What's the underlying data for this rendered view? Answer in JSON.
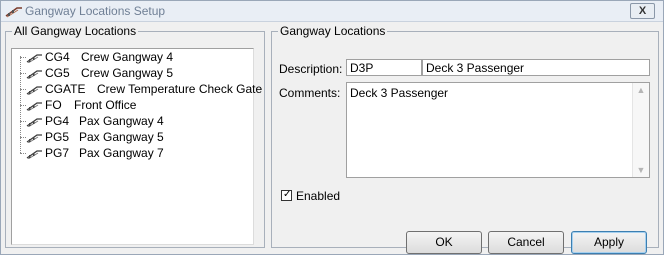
{
  "window": {
    "title": "Gangway Locations Setup",
    "close_glyph": "X",
    "icon": "gangway-icon"
  },
  "left_panel": {
    "legend": "All Gangway Locations",
    "items": [
      {
        "code": "CG4",
        "name": "Crew Gangway 4",
        "icon": "gangway-icon"
      },
      {
        "code": "CG5",
        "name": "Crew Gangway 5",
        "icon": "gangway-icon"
      },
      {
        "code": "CGATE",
        "name": "Crew Temperature Check Gate",
        "icon": "gangway-icon"
      },
      {
        "code": "FO",
        "name": "Front Office",
        "icon": "gangway-icon"
      },
      {
        "code": "PG4",
        "name": "Pax Gangway 4",
        "icon": "gangway-icon"
      },
      {
        "code": "PG5",
        "name": "Pax Gangway 5",
        "icon": "gangway-icon"
      },
      {
        "code": "PG7",
        "name": "Pax Gangway 7",
        "icon": "gangway-icon"
      }
    ]
  },
  "right_panel": {
    "legend": "Gangway Locations",
    "description_label": "Description:",
    "code_value": "D3P",
    "description_value": "Deck 3 Passenger",
    "comments_label": "Comments:",
    "comments_value": "Deck 3 Passenger",
    "enabled_label": "Enabled",
    "enabled_checked": true
  },
  "buttons": {
    "ok": "OK",
    "cancel": "Cancel",
    "apply": "Apply"
  }
}
